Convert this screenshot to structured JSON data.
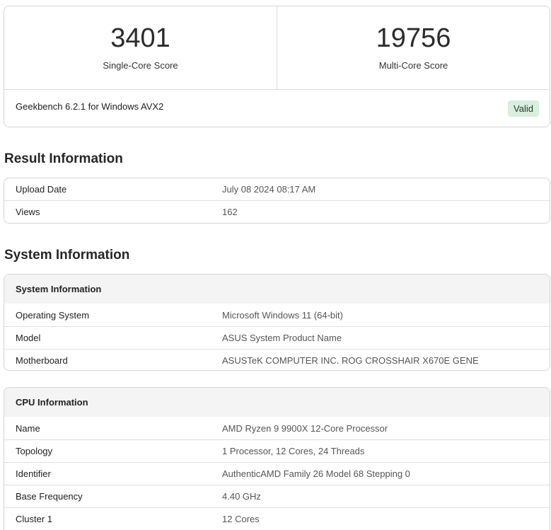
{
  "scores": {
    "single": {
      "value": "3401",
      "label": "Single-Core Score"
    },
    "multi": {
      "value": "19756",
      "label": "Multi-Core Score"
    },
    "version": "Geekbench 6.2.1 for Windows AVX2",
    "status": "Valid"
  },
  "result_info": {
    "heading": "Result Information",
    "rows": [
      {
        "label": "Upload Date",
        "value": "July 08 2024 08:17 AM"
      },
      {
        "label": "Views",
        "value": "162"
      }
    ]
  },
  "system_section": {
    "heading": "System Information",
    "card_title": "System Information",
    "rows": [
      {
        "label": "Operating System",
        "value": "Microsoft Windows 11 (64-bit)"
      },
      {
        "label": "Model",
        "value": "ASUS System Product Name"
      },
      {
        "label": "Motherboard",
        "value": "ASUSTeK COMPUTER INC. ROG CROSSHAIR X670E GENE"
      }
    ]
  },
  "cpu_info": {
    "card_title": "CPU Information",
    "rows": [
      {
        "label": "Name",
        "value": "AMD Ryzen 9 9900X 12-Core Processor"
      },
      {
        "label": "Topology",
        "value": "1 Processor, 12 Cores, 24 Threads"
      },
      {
        "label": "Identifier",
        "value": "AuthenticAMD Family 26 Model 68 Stepping 0"
      },
      {
        "label": "Base Frequency",
        "value": "4.40 GHz"
      },
      {
        "label": "Cluster 1",
        "value": "12 Cores"
      }
    ]
  },
  "colors": {
    "valid_badge_bg": "#d9eedd",
    "card_border": "#d6d6d6",
    "header_bg": "#f4f4f4"
  }
}
